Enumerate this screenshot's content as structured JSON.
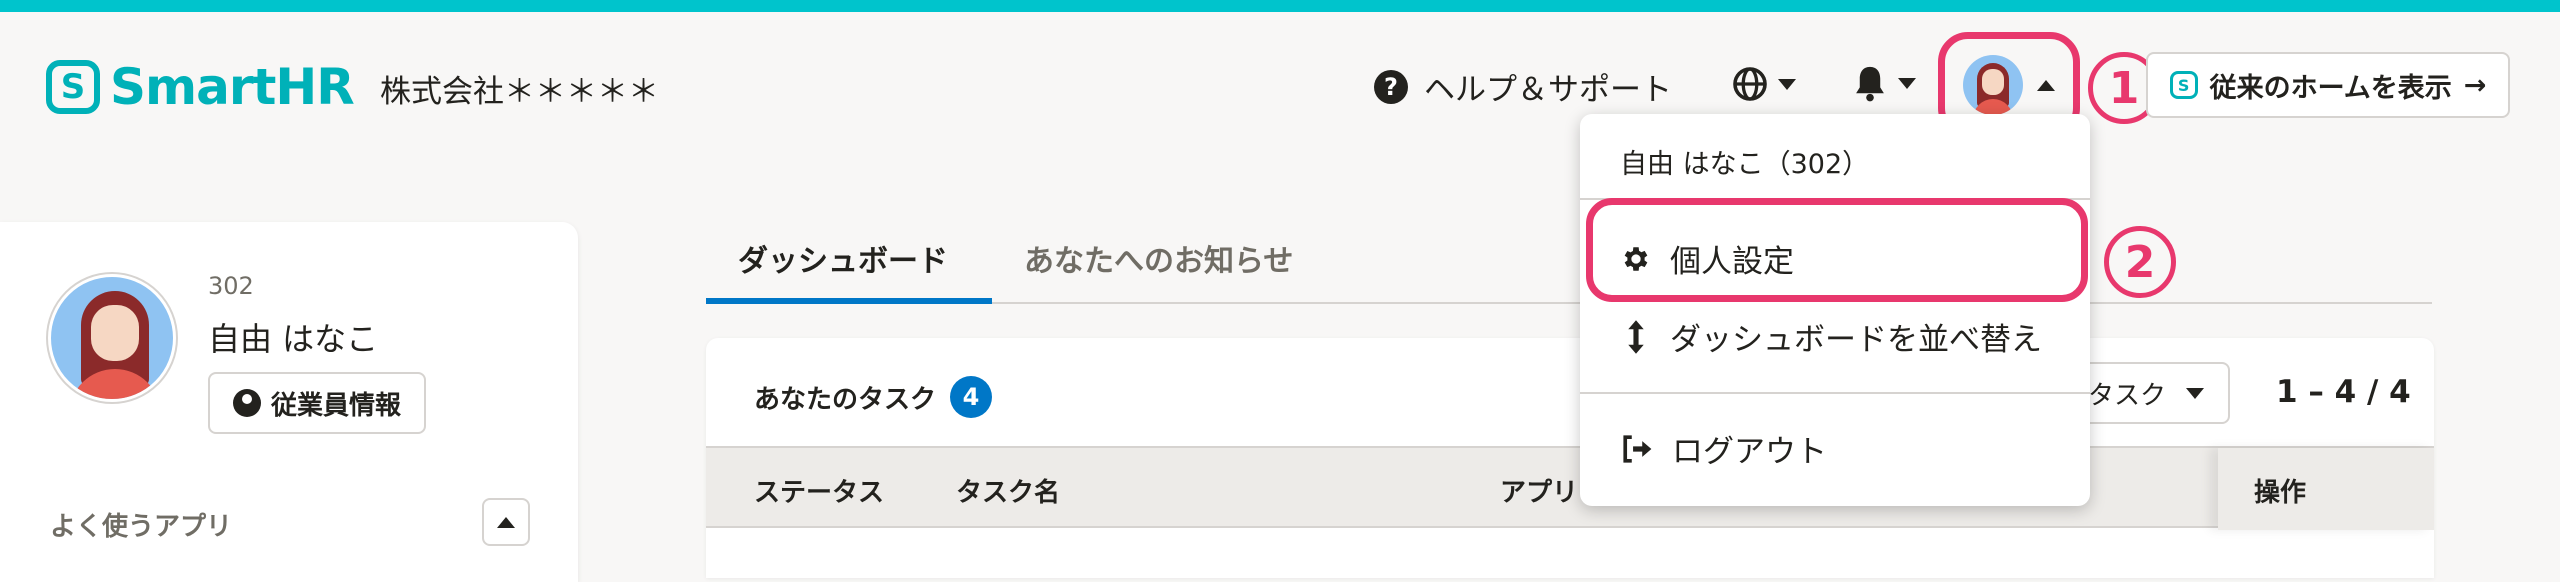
{
  "header": {
    "logo_mark": "S",
    "logo_text": "SmartHR",
    "company": "株式会社＊＊＊＊＊",
    "help_label": "ヘルプ＆サポート",
    "legacy_home_label": "従来のホームを表示",
    "legacy_arrow": "→"
  },
  "annotations": {
    "mark1": "1",
    "mark2": "2"
  },
  "user_menu": {
    "name_line": "自由 はなこ（302）",
    "items": [
      {
        "icon": "gear-icon",
        "label": "個人設定"
      },
      {
        "icon": "sort-icon",
        "label": "ダッシュボードを並べ替え"
      },
      {
        "icon": "logout-icon",
        "label": "ログアウト"
      }
    ]
  },
  "profile": {
    "employee_number": "302",
    "name": "自由 はなこ",
    "employee_info_button": "従業員情報",
    "favorite_apps_label": "よく使うアプリ"
  },
  "tabs": [
    {
      "label": "ダッシュボード",
      "active": true
    },
    {
      "label": "あなたへのお知らせ",
      "active": false
    }
  ],
  "tasks": {
    "title": "あなたのタスク",
    "count": "4",
    "filter_label": "タスク",
    "pagination": "1 – 4 / 4",
    "columns": [
      "ステータス",
      "タスク名",
      "アプリ",
      "操作"
    ]
  },
  "colors": {
    "brand": "#00c4cc",
    "annotation": "#e8386d",
    "accent": "#0077c7"
  }
}
